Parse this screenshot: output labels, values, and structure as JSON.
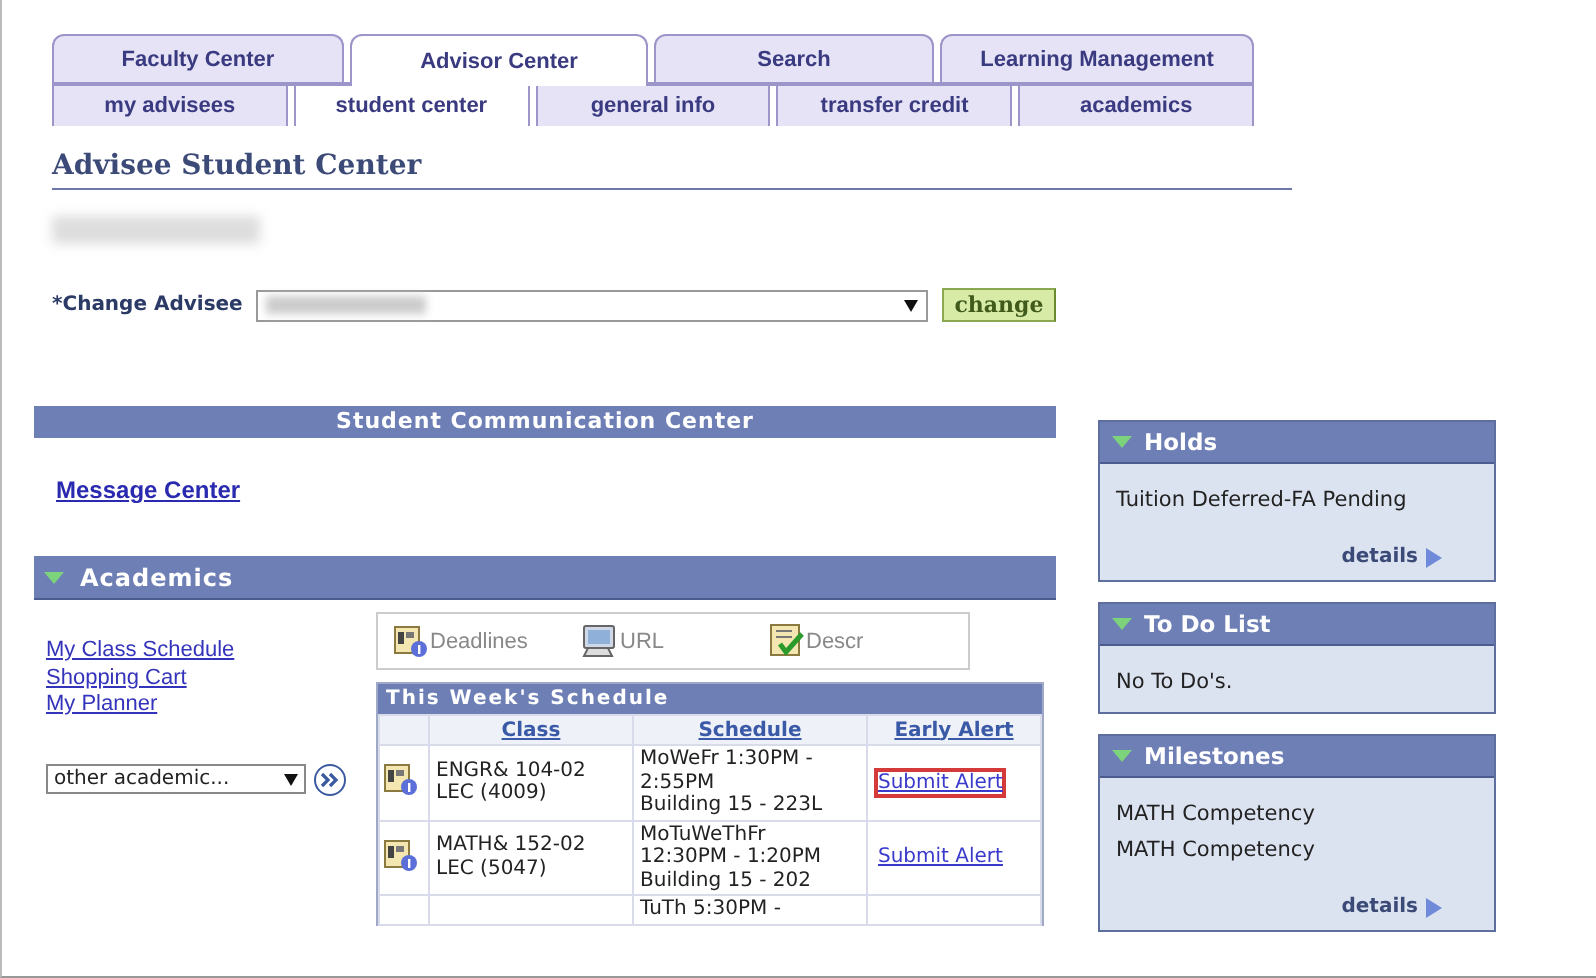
{
  "top_tabs": [
    {
      "label": "Faculty Center",
      "selected": false
    },
    {
      "label": "Advisor Center",
      "selected": true
    },
    {
      "label": "Search",
      "selected": false
    },
    {
      "label": "Learning Management",
      "selected": false
    }
  ],
  "sub_tabs": [
    {
      "label": "my advisees",
      "selected": false
    },
    {
      "label": "student center",
      "selected": true
    },
    {
      "label": "general info",
      "selected": false
    },
    {
      "label": "transfer credit",
      "selected": false
    },
    {
      "label": "academics",
      "selected": false
    }
  ],
  "page_title": "Advisee Student Center",
  "change_advisee": {
    "label": "*Change Advisee",
    "button": "change"
  },
  "communication_center": {
    "title": "Student Communication Center",
    "link": "Message Center"
  },
  "academics": {
    "title": "Academics",
    "expanded": true,
    "links": [
      "My Class Schedule",
      "Shopping Cart",
      "My Planner"
    ],
    "other_select": "other academic...",
    "legend": [
      {
        "kind": "deadlines",
        "label": "Deadlines"
      },
      {
        "kind": "url",
        "label": "URL"
      },
      {
        "kind": "descr",
        "label": "Descr"
      }
    ],
    "schedule": {
      "title": "This Week's Schedule",
      "columns": [
        "Class",
        "Schedule",
        "Early Alert"
      ],
      "rows": [
        {
          "icon": true,
          "class": [
            "ENGR& 104-02",
            "LEC (4009)"
          ],
          "schedule": [
            "MoWeFr 1:30PM -",
            "2:55PM",
            "Building 15 - 223L"
          ],
          "alert": "Submit Alert",
          "highlighted": true
        },
        {
          "icon": true,
          "class": [
            "MATH& 152-02",
            "LEC (5047)"
          ],
          "schedule": [
            "MoTuWeThFr",
            "12:30PM - 1:20PM",
            "Building 15 - 202"
          ],
          "alert": "Submit Alert",
          "highlighted": false
        },
        {
          "icon": false,
          "class": [],
          "schedule": [
            "TuTh 5:30PM -"
          ]
        }
      ]
    }
  },
  "side_panels": [
    {
      "title": "Holds",
      "expanded": true,
      "items": [
        "Tuition Deferred-FA Pending"
      ],
      "details": "details"
    },
    {
      "title": "To Do List",
      "expanded": true,
      "items": [
        "No To Do's."
      ]
    },
    {
      "title": "Milestones",
      "expanded": true,
      "items": [
        "MATH Competency",
        "MATH Competency"
      ],
      "details": "details"
    }
  ]
}
